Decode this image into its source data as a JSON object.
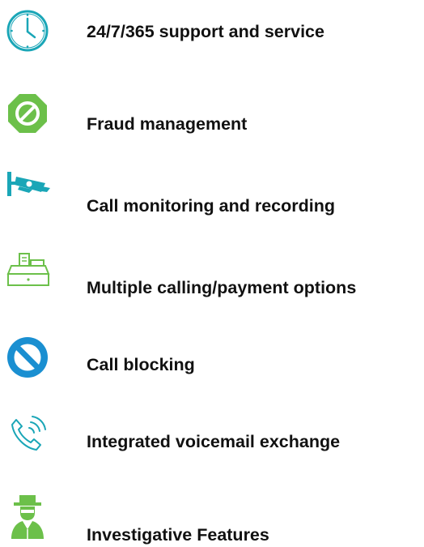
{
  "features": [
    {
      "label": "24/7/365 support and service",
      "icon": "clock-icon",
      "color": "#1aa6b7"
    },
    {
      "label": "Fraud management",
      "icon": "prohibited-octagon-icon",
      "color": "#6cc04a"
    },
    {
      "label": "Call monitoring and recording",
      "icon": "security-camera-icon",
      "color": "#1aa6b7"
    },
    {
      "label": "Multiple calling/payment options",
      "icon": "cash-register-icon",
      "color": "#6cc04a"
    },
    {
      "label": "Call blocking",
      "icon": "block-icon",
      "color": "#1a8fd1"
    },
    {
      "label": "Integrated voicemail exchange",
      "icon": "phone-ringing-icon",
      "color": "#1aa6b7"
    },
    {
      "label": "Investigative Features",
      "icon": "detective-icon",
      "color": "#6cc04a"
    }
  ]
}
